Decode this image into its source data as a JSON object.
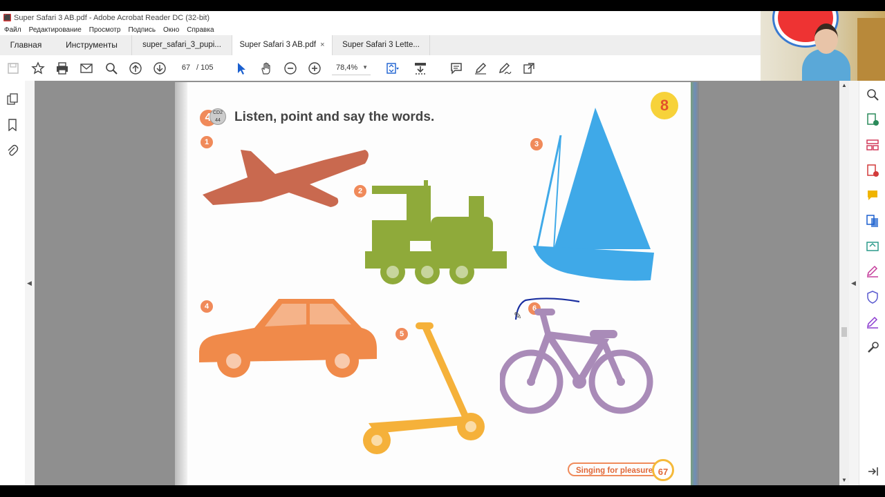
{
  "window": {
    "title": "Super Safari 3 AB.pdf - Adobe Acrobat Reader DC (32-bit)"
  },
  "menu": [
    "Файл",
    "Редактирование",
    "Просмотр",
    "Подпись",
    "Окно",
    "Справка"
  ],
  "tabs": {
    "home": "Главная",
    "tools": "Инструменты",
    "docs": [
      {
        "label": "super_safari_3_pupi..."
      },
      {
        "label": "Super Safari 3 AB.pdf",
        "close": "×"
      },
      {
        "label": "Super Safari 3 Lette..."
      }
    ]
  },
  "toolbar": {
    "page_current": "67",
    "page_total": "/ 105",
    "zoom": "78,4%",
    "icons": [
      "save-icon",
      "star-icon",
      "print-icon",
      "mail-icon",
      "search-icon",
      "prev-page-icon",
      "next-page-icon",
      "select-cursor-icon",
      "hand-icon",
      "zoom-out-icon",
      "zoom-in-icon",
      "fit-page-icon",
      "scroll-mode-icon",
      "comment-icon",
      "pen-icon",
      "sign-icon",
      "share-icon"
    ]
  },
  "page": {
    "exercise_number": "4",
    "cd_label": "CD2",
    "cd_track": "44",
    "instruction": "Listen, point and say the words.",
    "unit_badge": "8",
    "items": [
      {
        "number": "1",
        "object": "plane",
        "color": "#c9694f"
      },
      {
        "number": "2",
        "object": "train",
        "color": "#8faa3a"
      },
      {
        "number": "3",
        "object": "boat",
        "color": "#3fa9e8"
      },
      {
        "number": "4",
        "object": "car",
        "color": "#f08a4a"
      },
      {
        "number": "5",
        "object": "scooter",
        "color": "#f5b13a"
      },
      {
        "number": "6",
        "object": "bike",
        "color": "#a98bb8"
      }
    ],
    "footer_label": "Singing for pleasure",
    "page_number": "67"
  },
  "colors": {
    "canvas": "#8f8f8f",
    "accent": "#f08a5a",
    "ink": "#1a2fa0"
  }
}
